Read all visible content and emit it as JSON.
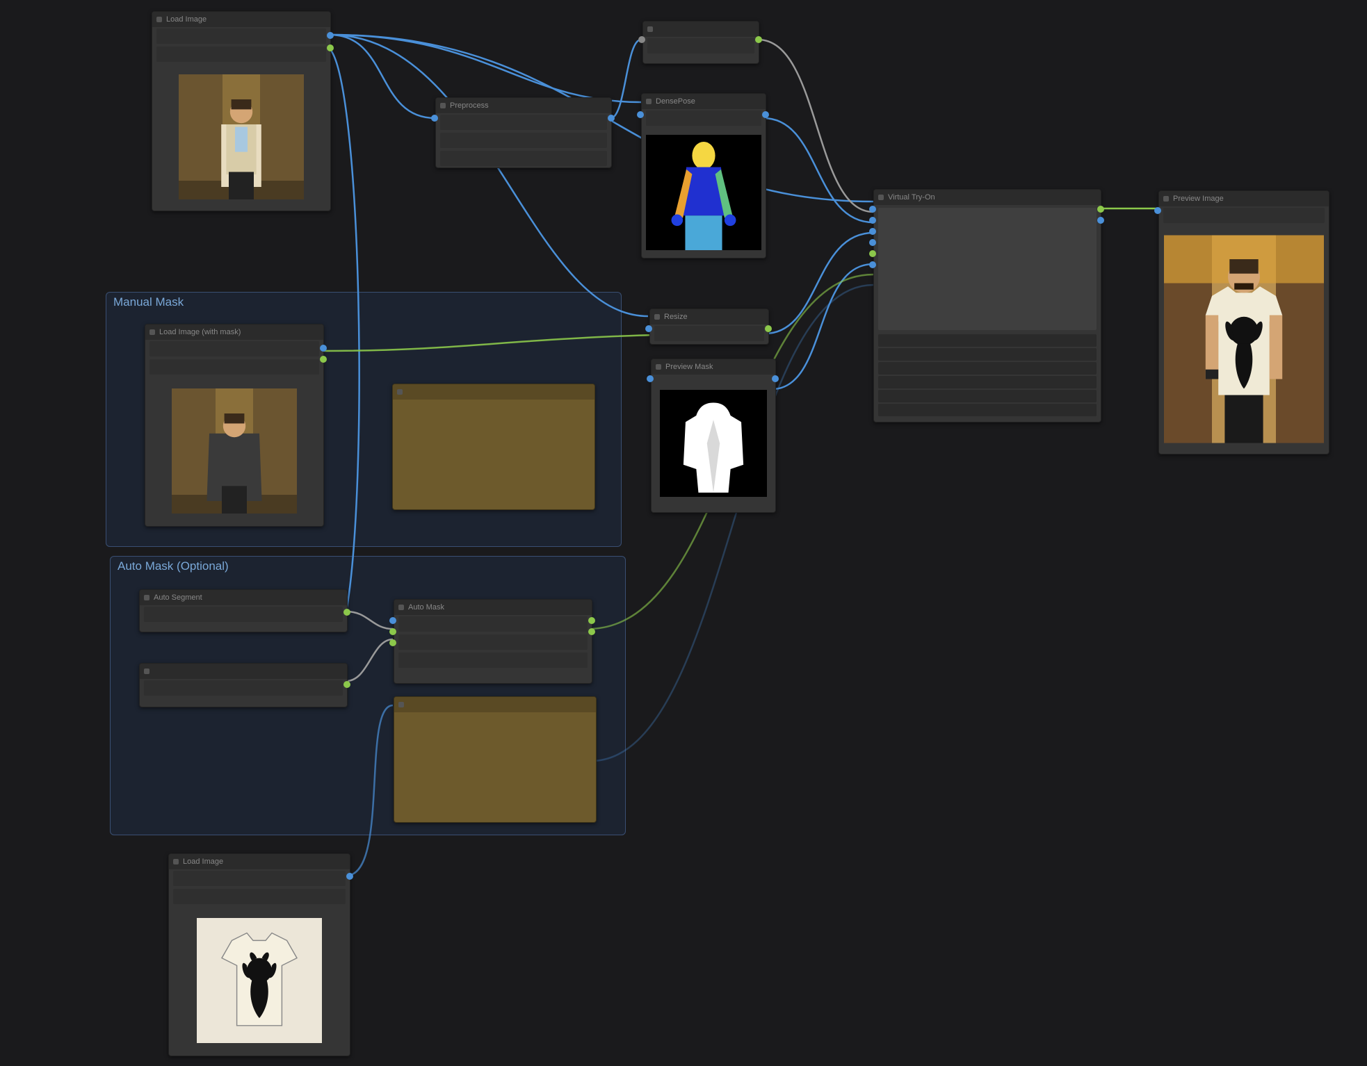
{
  "groups": {
    "manual_mask": {
      "title": "Manual Mask"
    },
    "auto_mask": {
      "title": "Auto Mask (Optional)"
    }
  },
  "nodes": {
    "load_input": {
      "title": "Load Image",
      "field1": "",
      "field2": ""
    },
    "preprocess": {
      "title": "Preprocess",
      "field1": ""
    },
    "densepose": {
      "title": "DensePose",
      "field1": ""
    },
    "manual_load": {
      "title": "Load Image (with mask)",
      "field1": "",
      "field2": ""
    },
    "manual_brown": {
      "title": ""
    },
    "resize_mask": {
      "title": "Resize",
      "field1": ""
    },
    "mask_preview": {
      "title": "Preview Mask"
    },
    "auto_seg": {
      "title": "Auto Segment",
      "field1": "",
      "field2": "",
      "field3": ""
    },
    "auto_mask_node": {
      "title": "Auto Mask",
      "field1": "",
      "field2": "",
      "field3": ""
    },
    "auto_brown": {
      "title": ""
    },
    "garment_load": {
      "title": "Load Image",
      "field1": "",
      "field2": ""
    },
    "main_process": {
      "title": "Virtual Try-On",
      "p1": "",
      "p2": "",
      "p3": "",
      "p4": "",
      "p5": "",
      "p6": ""
    },
    "result_preview": {
      "title": "Preview Image",
      "field1": ""
    }
  }
}
